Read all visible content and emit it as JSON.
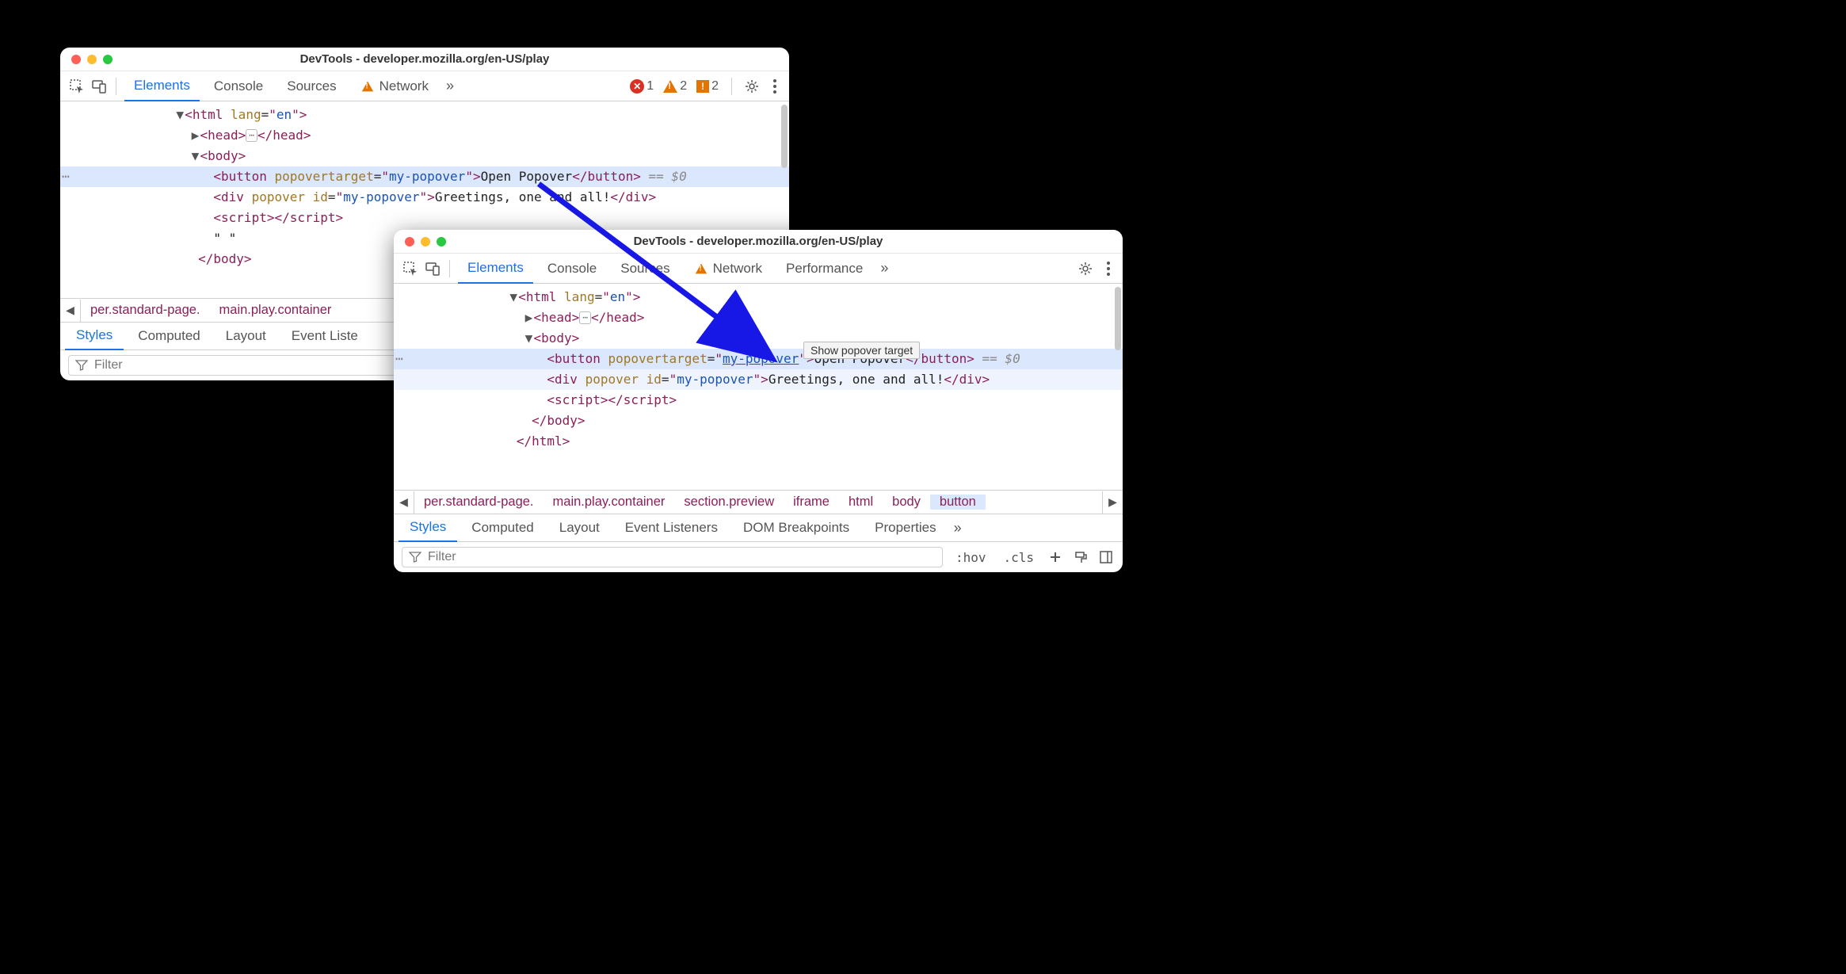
{
  "title": "DevTools - developer.mozilla.org/en-US/play",
  "winA": {
    "tabs": [
      "Elements",
      "Console",
      "Sources",
      "Network"
    ],
    "activeTab": 0,
    "errors": "1",
    "warnings": "2",
    "info": "2",
    "crumbs": [
      "per.standard-page.",
      "main.play.container"
    ],
    "subtabs": [
      "Styles",
      "Computed",
      "Layout",
      "Event Liste"
    ],
    "activeSubtab": 0,
    "filterPlaceholder": "Filter",
    "dom": {
      "htmlOpen": {
        "lang": "en"
      },
      "headEllipsis": "⋯",
      "button": {
        "attr": "popovertarget",
        "val": "my-popover",
        "text": "Open Popover",
        "linked": false
      },
      "div": {
        "attrPopover": "popover",
        "attrId": "id",
        "idVal": "my-popover",
        "text": "Greetings, one and all!"
      },
      "spaceRow": "\" \"",
      "eq0": "== $0"
    }
  },
  "winB": {
    "tabs": [
      "Elements",
      "Console",
      "Sources",
      "Network",
      "Performance"
    ],
    "activeTab": 0,
    "crumbs": [
      "per.standard-page.",
      "main.play.container",
      "section.preview",
      "iframe",
      "html",
      "body",
      "button"
    ],
    "crumbSelected": 6,
    "subtabs": [
      "Styles",
      "Computed",
      "Layout",
      "Event Listeners",
      "DOM Breakpoints",
      "Properties"
    ],
    "activeSubtab": 0,
    "filterPlaceholder": "Filter",
    "hov": ":hov",
    "cls": ".cls",
    "tooltip": "Show popover target",
    "dom": {
      "htmlOpen": {
        "lang": "en"
      },
      "headEllipsis": "⋯",
      "button": {
        "attr": "popovertarget",
        "val": "my-popover",
        "text": "Open Popover",
        "linked": true
      },
      "div": {
        "attrPopover": "popover",
        "attrId": "id",
        "idVal": "my-popover",
        "text": "Greetings, one and all!"
      },
      "eq0": "== $0"
    }
  }
}
